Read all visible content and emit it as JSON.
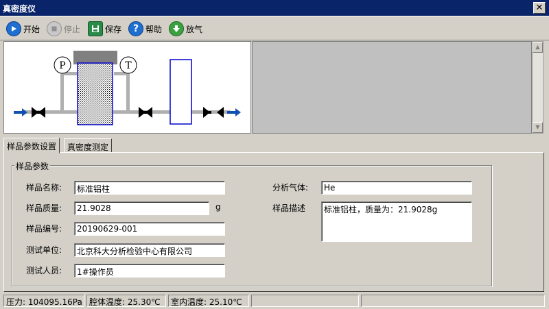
{
  "window": {
    "title": "真密度仪",
    "close_glyph": "✕"
  },
  "toolbar": {
    "start": {
      "label": "开始",
      "icon": "play-icon",
      "color": "#1f6fd0"
    },
    "stop": {
      "label": "停止",
      "icon": "stop-icon",
      "color": "#a0a0a0"
    },
    "save": {
      "label": "保存",
      "icon": "save-icon",
      "color": "#208040"
    },
    "help": {
      "label": "帮助",
      "icon": "help-icon",
      "color": "#1f6fd0"
    },
    "vent": {
      "label": "放气",
      "icon": "vent-icon",
      "color": "#3aa040"
    }
  },
  "diagram": {
    "pressure_label": "P",
    "temperature_label": "T",
    "flow_color": "#1050b0",
    "pipe_color": "#b0b0b0",
    "vessel_border": "#0000cc"
  },
  "tabs": [
    {
      "label": "样品参数设置",
      "active": true
    },
    {
      "label": "真密度测定",
      "active": false
    }
  ],
  "sample_group": {
    "title": "样品参数",
    "name_label": "样品名称:",
    "name_value": "标准铝柱",
    "mass_label": "样品质量:",
    "mass_value": "21.9028",
    "mass_unit": "g",
    "id_label": "样品编号:",
    "id_value": "20190629-001",
    "org_label": "测试单位:",
    "org_value": "北京科大分析检验中心有限公司",
    "operator_label": "测试人员:",
    "operator_value": "1#操作员",
    "gas_label": "分析气体:",
    "gas_value": "He",
    "desc_label": "样品描述",
    "desc_value": "标准铝柱，质量为：21.9028g"
  },
  "status": {
    "pressure": "压力: 104095.16Pa",
    "chamber_temp": "腔体温度: 25.30℃",
    "room_temp": "室内温度: 25.10℃",
    "empty1": "",
    "empty2": ""
  }
}
